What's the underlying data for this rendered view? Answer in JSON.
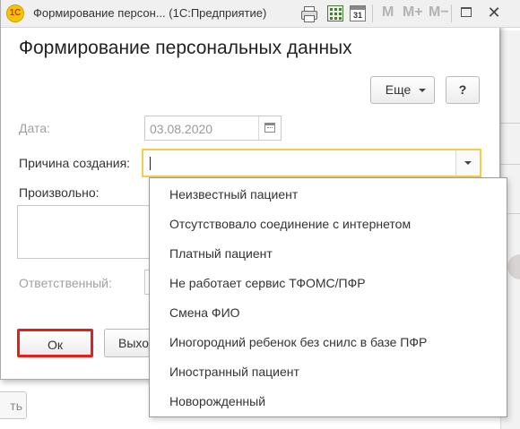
{
  "window": {
    "title": "Формирование персон... (1С:Предприятие)",
    "app_logo": "1С",
    "calendar_icon_text": "31",
    "memory_buttons": [
      "M",
      "M+",
      "M−"
    ],
    "close_symbol": "✕"
  },
  "form": {
    "title": "Формирование персональных данных",
    "more_label": "Еще",
    "help_label": "?",
    "date_label": "Дата:",
    "date_value": "03.08.2020",
    "reason_label": "Причина создания:",
    "reason_value": "",
    "arbitrary_label": "Произвольно:",
    "responsible_label": "Ответственный:",
    "ok_label": "Ок",
    "exit_label": "Выход"
  },
  "dropdown": {
    "items": [
      "Неизвестный пациент",
      "Отсутствовало соединение с интернетом",
      "Платный пациент",
      "Не работает сервис ТФОМС/ПФР",
      "Смена ФИО",
      "Иногородний ребенок без снилс в базе ПФР",
      "Иностранный пациент",
      "Новорожденный"
    ]
  },
  "background": {
    "partial_button_label": "ть"
  },
  "colors": {
    "focus_border": "#f2cf4a",
    "highlight_frame": "#e5201a"
  }
}
